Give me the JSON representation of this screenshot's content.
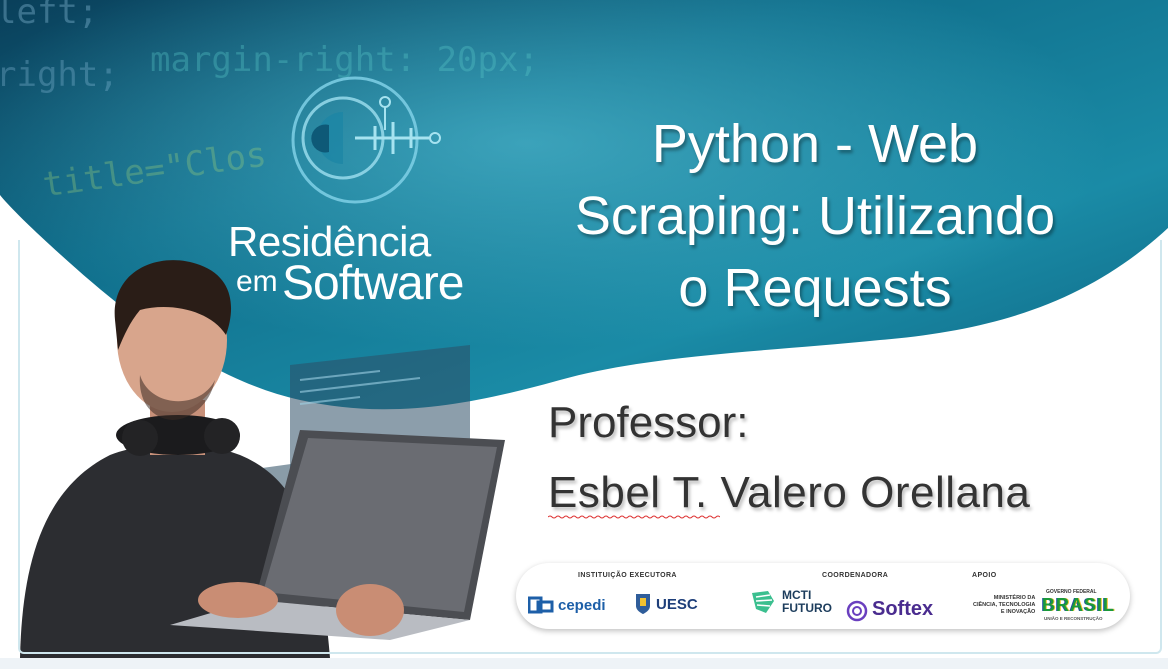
{
  "background_code": [
    "left;",
    "margin-right: 20px;",
    "right;",
    "title=\"Clos"
  ],
  "brand": {
    "line1": "Residência",
    "line2_small": "em",
    "line2_large": "Software"
  },
  "title": {
    "line1": "Python - Web",
    "line2": "Scraping: Utilizando",
    "line3": "o Requests"
  },
  "professor": {
    "label": "Professor:",
    "name": "Esbel T. Valero Orellana"
  },
  "sponsors": {
    "executing_label": "INSTITUIÇÃO EXECUTORA",
    "coordinating_label": "COORDENADORA",
    "support_label": "APOIO",
    "cepedi": "cepedi",
    "uesc": "UESC",
    "mcti_line1": "MCTI",
    "mcti_line2": "FUTURO",
    "softex": "Softex",
    "ministry_line1": "MINISTÉRIO DA",
    "ministry_line2": "CIÊNCIA, TECNOLOGIA",
    "ministry_line3": "E INOVAÇÃO",
    "gov_line1": "GOVERNO FEDERAL",
    "gov_word": "BRASIL",
    "gov_line2": "UNIÃO E RECONSTRUÇÃO"
  },
  "colors": {
    "teal_dark": "#0b5f79",
    "teal_mid": "#1d8fa8",
    "teal_light": "#4cb4c8",
    "title_text": "#ffffff",
    "body_text": "#333333"
  }
}
